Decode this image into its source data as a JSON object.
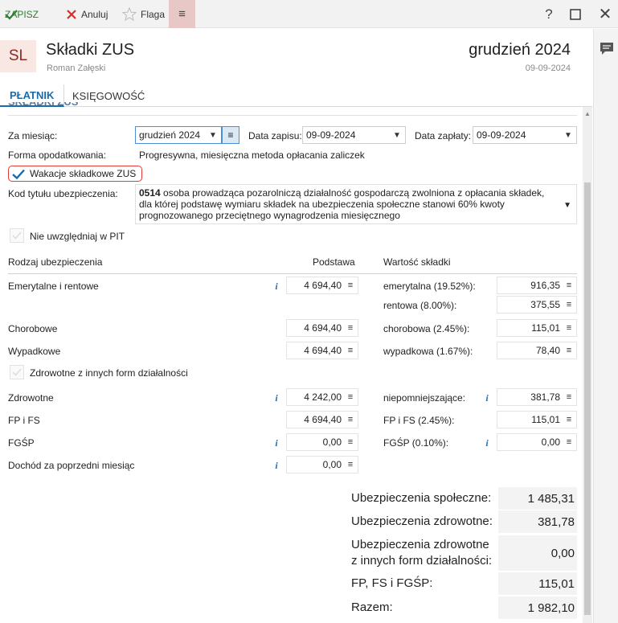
{
  "toolbar": {
    "save_label": "ZAPISZ",
    "cancel_label": "Anuluj",
    "flag_label": "Flaga",
    "menu_glyph": "≡",
    "help_glyph": "?",
    "close_glyph": "✕"
  },
  "header": {
    "avatar": "SL",
    "title": "Składki ZUS",
    "subtitle": "Roman Załęski",
    "period": "grudzień 2024",
    "period_date": "09-09-2024"
  },
  "tabs": [
    {
      "label": "PŁATNIK",
      "active": true
    },
    {
      "label": "KSIĘGOWOŚĆ",
      "active": false
    }
  ],
  "section_title": "SKŁADKI ZUS",
  "form": {
    "month_label": "Za miesiąc:",
    "month_value": "grudzień 2024",
    "record_date_label": "Data zapisu:",
    "record_date_value": "09-09-2024",
    "pay_date_label": "Data zapłaty:",
    "pay_date_value": "09-09-2024",
    "tax_form_label": "Forma opodatkowania:",
    "tax_form_value": "Progresywna, miesięczna metoda opłacania zaliczek",
    "vacation_label": "Wakacje składkowe ZUS",
    "vacation_checked": true,
    "code_label": "Kod tytułu ubezpieczenia:",
    "code_number": "0514",
    "code_desc": "osoba prowadząca pozarolniczą działalność gospodarczą zwolniona z opłacania składek, dla której podstawę wymiaru składek na ubezpieczenia społeczne stanowi 60% kwoty prognozowanego przeciętnego wynagrodzenia miesięcznego",
    "exclude_pit_label": "Nie uwzględniaj w PIT",
    "health_other_label": "Zdrowotne z innych form działalności"
  },
  "table": {
    "col_type": "Rodzaj ubezpieczenia",
    "col_base": "Podstawa",
    "col_value": "Wartość składki",
    "rows": {
      "emerytalne": {
        "label": "Emerytalne i rentowe",
        "base": "4 694,40"
      },
      "emerytalna_sub": {
        "label": "emerytalna (19.52%):",
        "value": "916,35"
      },
      "rentowa_sub": {
        "label": "rentowa (8.00%):",
        "value": "375,55"
      },
      "chorobowe": {
        "label": "Chorobowe",
        "base": "4 694,40",
        "sub_label": "chorobowa (2.45%):",
        "value": "115,01"
      },
      "wypadkowe": {
        "label": "Wypadkowe",
        "base": "4 694,40",
        "sub_label": "wypadkowa (1.67%):",
        "value": "78,40"
      },
      "zdrowotne": {
        "label": "Zdrowotne",
        "base": "4 242,00",
        "sub_label": "niepomniejszające:",
        "value": "381,78"
      },
      "fpfs": {
        "label": "FP i FS",
        "base": "4 694,40",
        "sub_label": "FP i FS (2.45%):",
        "value": "115,01"
      },
      "fgsp": {
        "label": "FGŚP",
        "base": "0,00",
        "sub_label": "FGŚP (0.10%):",
        "value": "0,00"
      },
      "dochod": {
        "label": "Dochód za poprzedni miesiąc",
        "base": "0,00"
      }
    }
  },
  "summary": {
    "social_label": "Ubezpieczenia społeczne:",
    "social_value": "1 485,31",
    "health_label": "Ubezpieczenia zdrowotne:",
    "health_value": "381,78",
    "health_other_label_1": "Ubezpieczenia zdrowotne",
    "health_other_label_2": "z innych form działalności:",
    "health_other_value": "0,00",
    "fund_label": "FP, FS i FGŚP:",
    "fund_value": "115,01",
    "total_label": "Razem:",
    "total_value": "1 982,10"
  },
  "colors": {
    "accent": "#1c6aa6",
    "save_green": "#2e7d32",
    "cancel_red": "#d32f2f",
    "highlight_red": "#e53935"
  }
}
